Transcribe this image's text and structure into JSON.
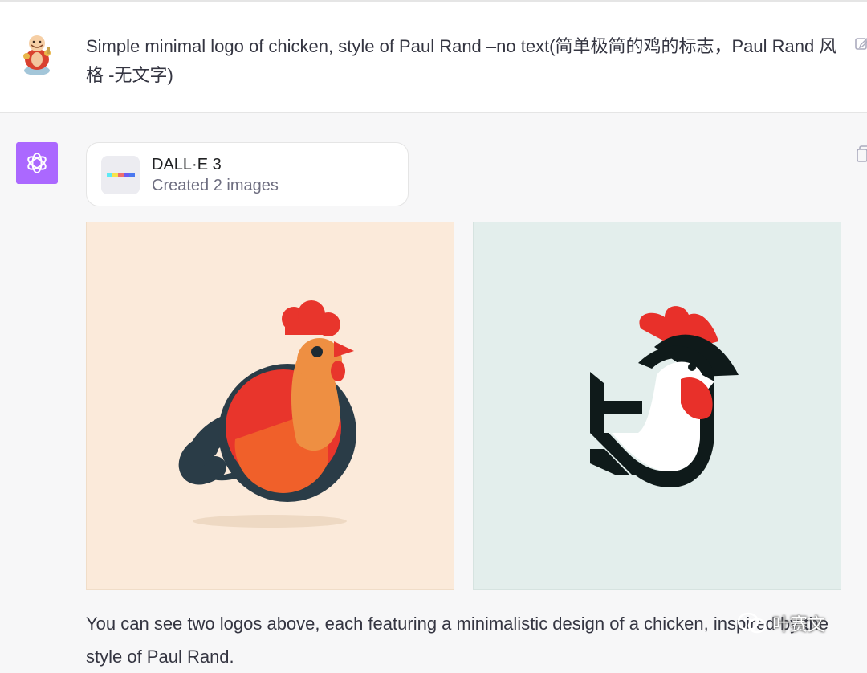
{
  "user_message": {
    "text": "Simple minimal logo of chicken, style of Paul Rand –no text(简单极简的鸡的标志，Paul Rand 风格 -无文字)"
  },
  "assistant": {
    "tool_card": {
      "title": "DALL·E 3",
      "subtitle": "Created 2 images",
      "icon_colors": [
        "#5de9f5",
        "#f7e34a",
        "#f06e6e",
        "#6b5cf2",
        "#4a78f0"
      ]
    },
    "images": [
      {
        "description": "rooster logo, warm colors",
        "background": "#fbeada"
      },
      {
        "description": "chicken logo, black white red",
        "background": "#e3eeec"
      }
    ],
    "reply_text": "You can see two logos above, each featuring a minimalistic design of a chicken, inspired by the style of Paul Rand."
  },
  "watermark": {
    "text": "叶赛文"
  },
  "colors": {
    "gpt_avatar": "#ab68ff",
    "page_bg": "#f7f7f8",
    "user_bg": "#ffffff"
  }
}
